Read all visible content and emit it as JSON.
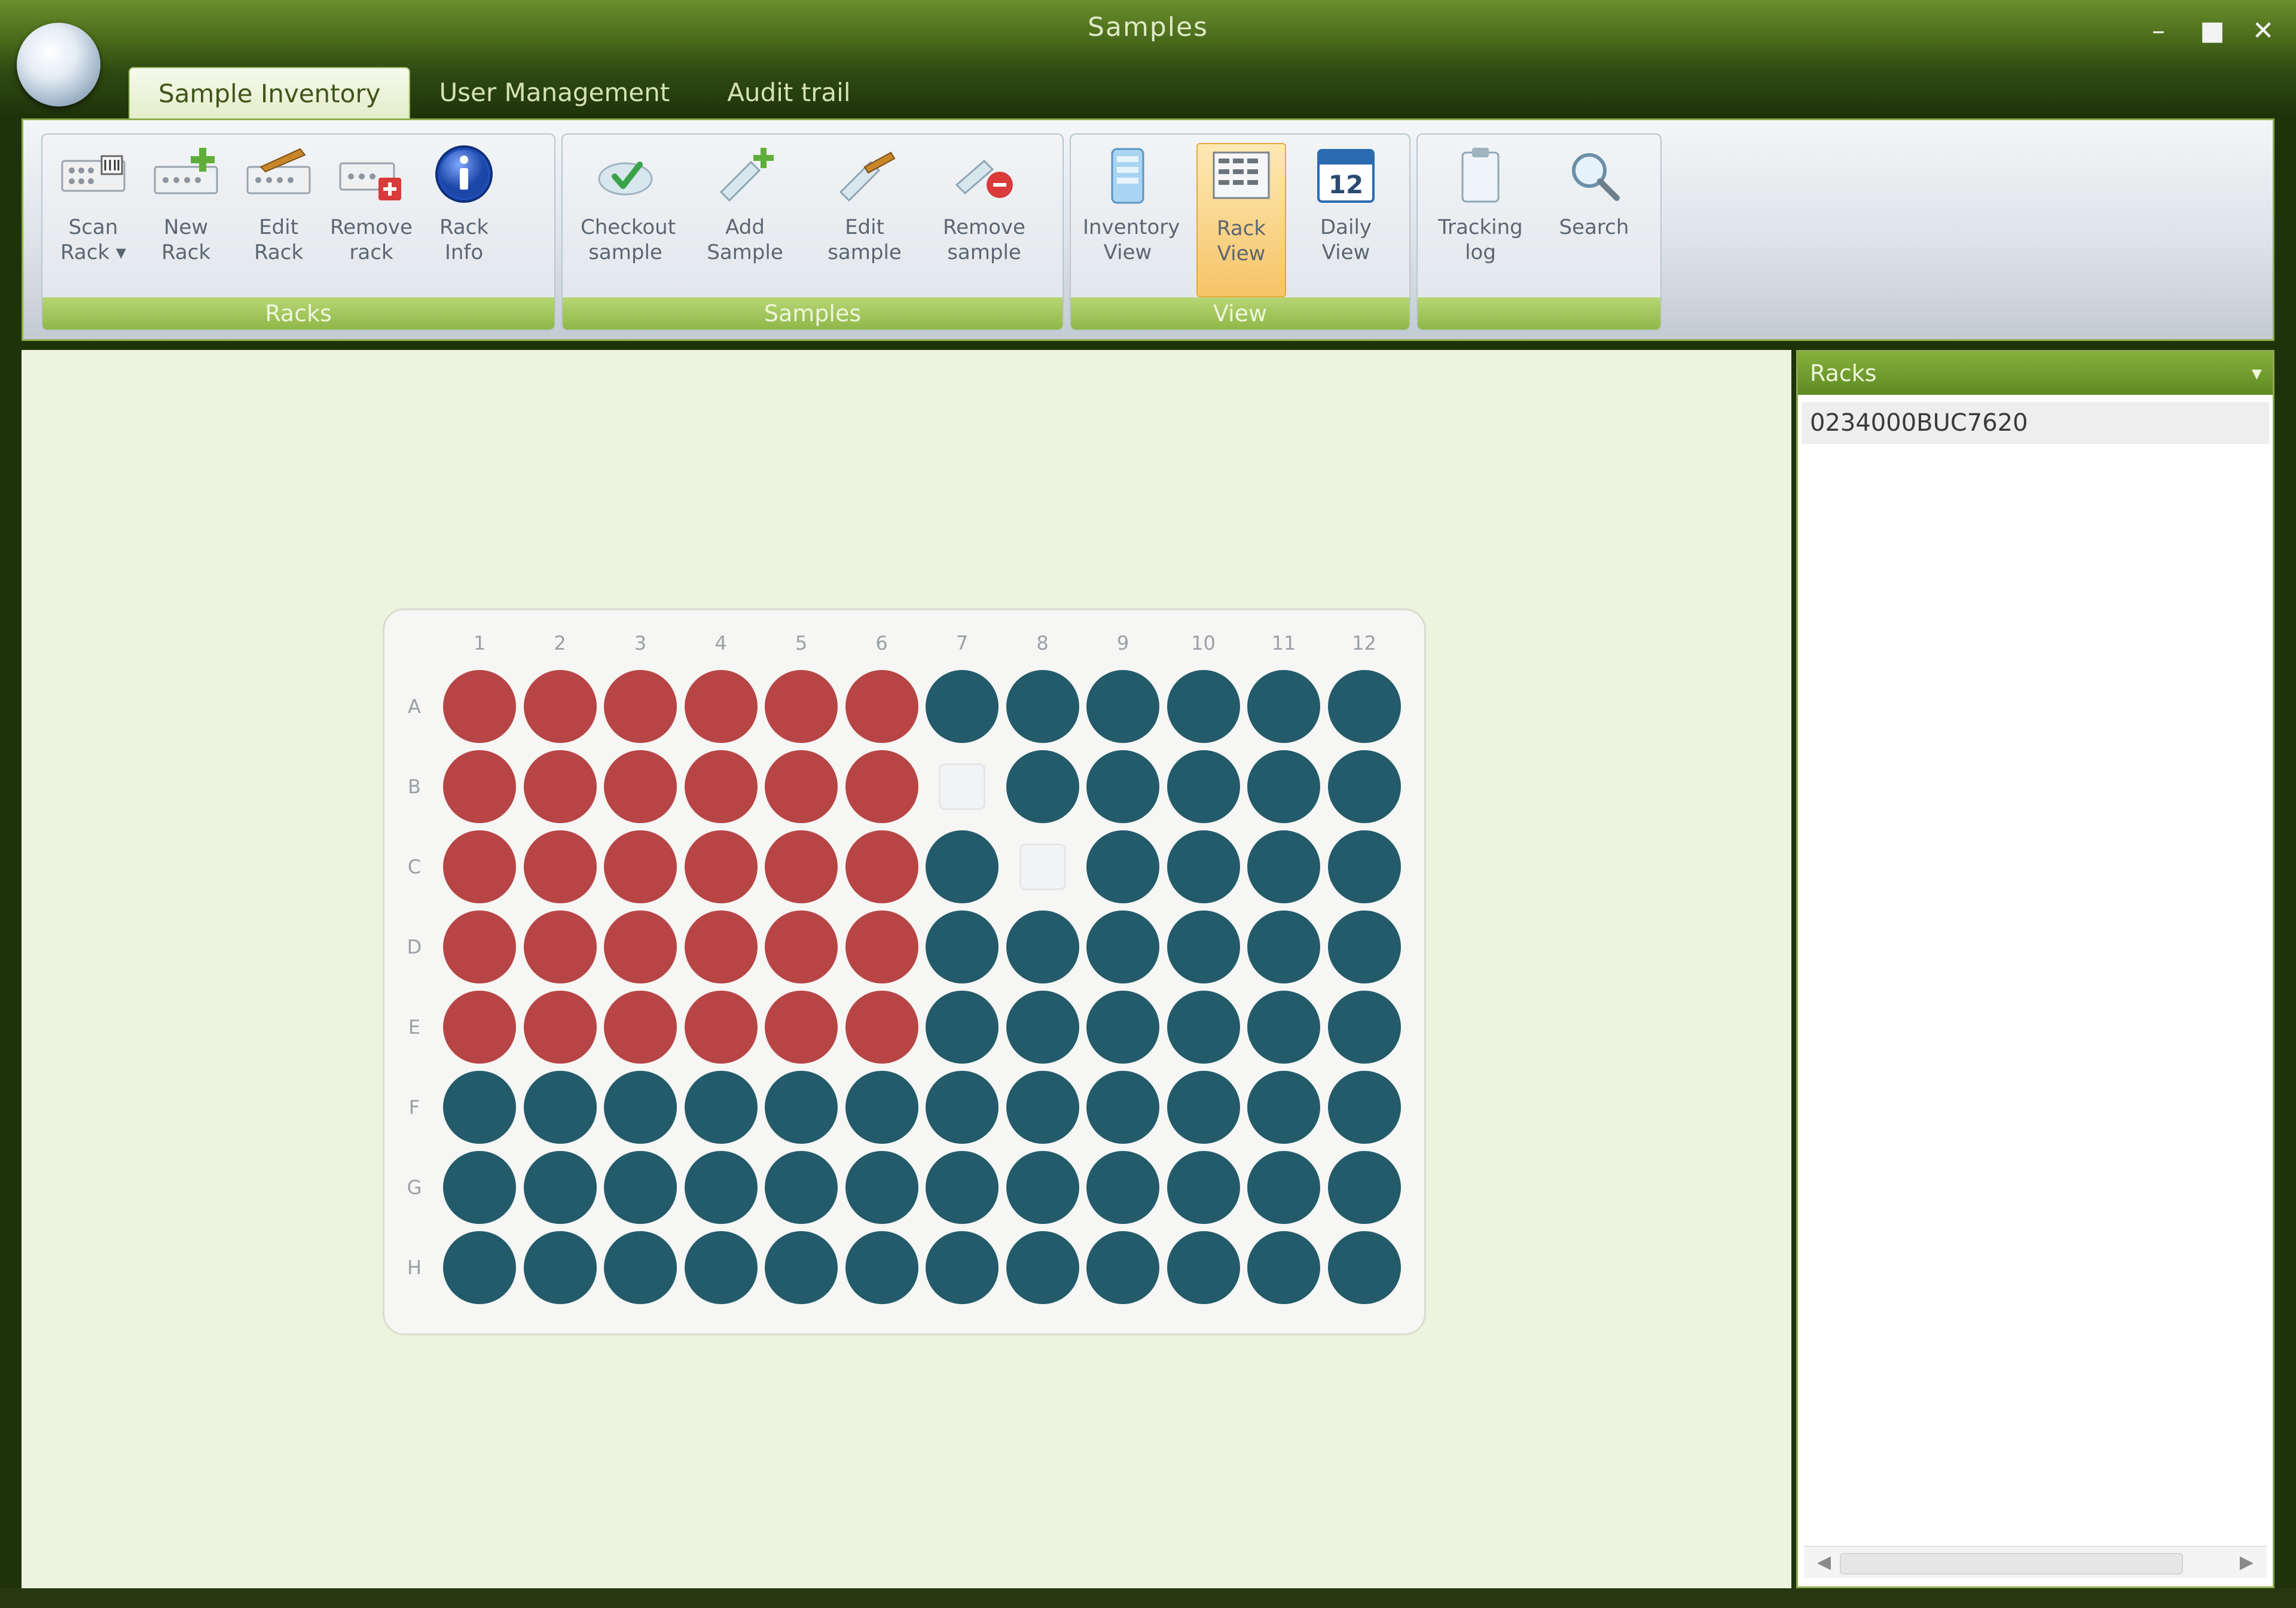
{
  "window": {
    "title": "Samples",
    "controls": {
      "minimize": "–",
      "maximize": "■",
      "close": "✕"
    }
  },
  "ribbon": {
    "tabs": [
      {
        "label": "Sample Inventory",
        "active": true
      },
      {
        "label": "User Management",
        "active": false
      },
      {
        "label": "Audit trail",
        "active": false
      }
    ],
    "groups": [
      {
        "label": "Racks",
        "buttons": [
          {
            "label": "Scan\nRack ▾",
            "icon": "scan-rack-icon"
          },
          {
            "label": "New\nRack",
            "icon": "new-rack-icon"
          },
          {
            "label": "Edit\nRack",
            "icon": "edit-rack-icon"
          },
          {
            "label": "Remove\nrack",
            "icon": "remove-rack-icon"
          },
          {
            "label": "Rack\nInfo",
            "icon": "info-icon"
          }
        ]
      },
      {
        "label": "Samples",
        "buttons": [
          {
            "label": "Checkout\nsample",
            "icon": "checkout-sample-icon"
          },
          {
            "label": "Add\nSample",
            "icon": "add-sample-icon"
          },
          {
            "label": "Edit\nsample",
            "icon": "edit-sample-icon"
          },
          {
            "label": "Remove\nsample",
            "icon": "remove-sample-icon"
          }
        ]
      },
      {
        "label": "View",
        "buttons": [
          {
            "label": "Inventory\nView",
            "icon": "inventory-view-icon"
          },
          {
            "label": "Rack\nView",
            "icon": "rack-view-icon",
            "selected": true
          },
          {
            "label": "Daily\nView",
            "icon": "calendar-icon"
          }
        ]
      },
      {
        "label": "",
        "buttons": [
          {
            "label": "Tracking\nlog",
            "icon": "tracking-log-icon"
          },
          {
            "label": "Search",
            "icon": "search-icon"
          }
        ]
      }
    ]
  },
  "plate": {
    "columns": [
      "1",
      "2",
      "3",
      "4",
      "5",
      "6",
      "7",
      "8",
      "9",
      "10",
      "11",
      "12"
    ],
    "rows": [
      "A",
      "B",
      "C",
      "D",
      "E",
      "F",
      "G",
      "H"
    ],
    "wells": [
      [
        "r",
        "r",
        "r",
        "r",
        "r",
        "r",
        "t",
        "t",
        "t",
        "t",
        "t",
        "t"
      ],
      [
        "r",
        "r",
        "r",
        "r",
        "r",
        "r",
        "e",
        "t",
        "t",
        "t",
        "t",
        "t"
      ],
      [
        "r",
        "r",
        "r",
        "r",
        "r",
        "r",
        "t",
        "e",
        "t",
        "t",
        "t",
        "t"
      ],
      [
        "r",
        "r",
        "r",
        "r",
        "r",
        "r",
        "t",
        "t",
        "t",
        "t",
        "t",
        "t"
      ],
      [
        "r",
        "r",
        "r",
        "r",
        "r",
        "r",
        "t",
        "t",
        "t",
        "t",
        "t",
        "t"
      ],
      [
        "t",
        "t",
        "t",
        "t",
        "t",
        "t",
        "t",
        "t",
        "t",
        "t",
        "t",
        "t"
      ],
      [
        "t",
        "t",
        "t",
        "t",
        "t",
        "t",
        "t",
        "t",
        "t",
        "t",
        "t",
        "t"
      ],
      [
        "t",
        "t",
        "t",
        "t",
        "t",
        "t",
        "t",
        "t",
        "t",
        "t",
        "t",
        "t"
      ]
    ],
    "colors": {
      "red": "#b84545",
      "teal": "#235b6a"
    }
  },
  "panel": {
    "title": "Racks",
    "pin": "▾",
    "items": [
      "0234000BUC7620"
    ]
  }
}
